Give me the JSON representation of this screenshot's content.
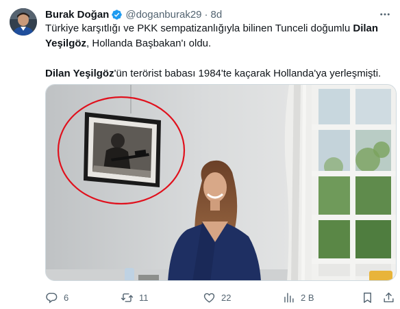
{
  "author": {
    "name": "Burak Doğan",
    "handle": "@doganburak29",
    "time": "8d"
  },
  "tweet": {
    "line1_part1": "Türkiye karşıtlığı ve PKK sempatizanlığıyla bilinen Tunceli doğumlu ",
    "line1_bold": "Dilan Yeşilgöz",
    "line1_part2": ", Hollanda Başbakan'ı oldu.",
    "line2_bold": "Dilan Yeşilgöz",
    "line2_part": "'ün terörist babası 1984'te kaçarak Hollanda'ya yerleşmişti."
  },
  "actions": {
    "replies": "6",
    "reposts": "11",
    "likes": "22",
    "views": "2 B"
  },
  "colors": {
    "text": "#0f1419",
    "secondary": "#536471",
    "verified": "#1d9bf0",
    "annotation_circle": "#e0101c"
  },
  "icons": [
    "verified-badge-icon",
    "more-icon",
    "reply-icon",
    "repost-icon",
    "like-icon",
    "views-icon",
    "bookmark-icon",
    "share-icon"
  ]
}
